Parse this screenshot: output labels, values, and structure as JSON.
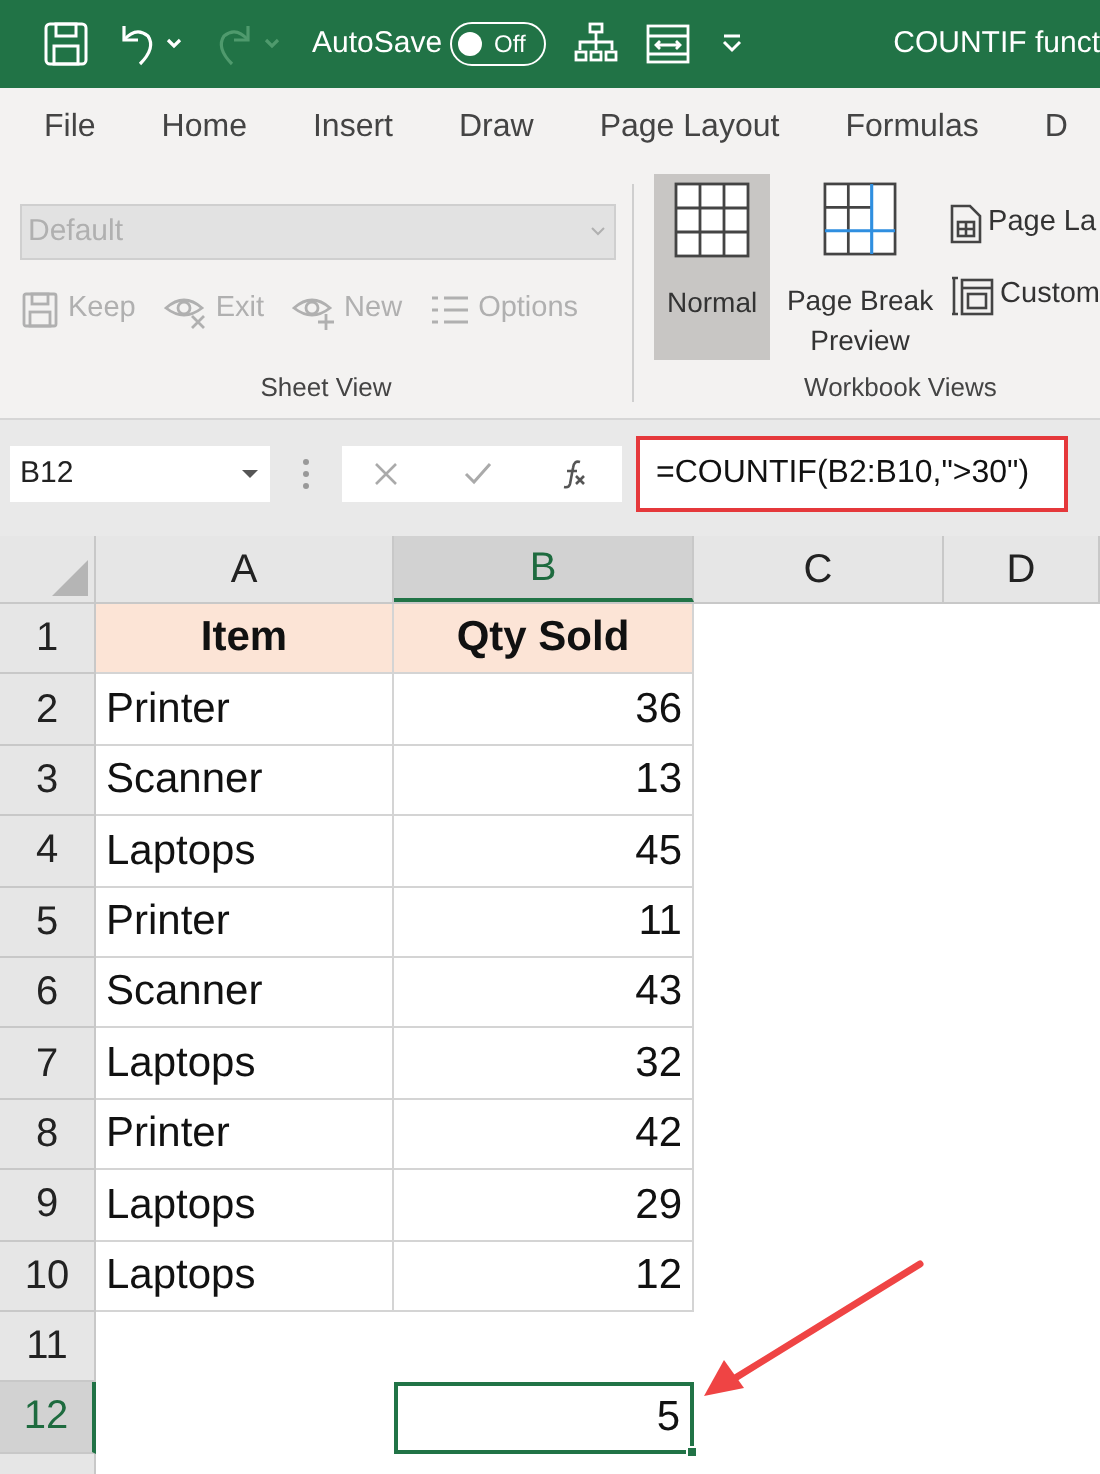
{
  "title_bar": {
    "autosave_label": "AutoSave",
    "autosave": {
      "on": false,
      "label": "Off"
    },
    "title": "COUNTIF funct"
  },
  "menu_tabs": [
    {
      "label": "File",
      "selected": false
    },
    {
      "label": "Home",
      "selected": false
    },
    {
      "label": "Insert",
      "selected": false
    },
    {
      "label": "Draw",
      "selected": false
    },
    {
      "label": "Page Layout",
      "selected": false
    },
    {
      "label": "Formulas",
      "selected": false
    },
    {
      "label": "D",
      "selected": false
    }
  ],
  "ribbon": {
    "sheet_view": {
      "style_dropdown": {
        "value": "Default",
        "disabled": true
      },
      "buttons": [
        {
          "kind": "keep",
          "label": "Keep",
          "disabled": true
        },
        {
          "kind": "exit",
          "label": "Exit",
          "disabled": true
        },
        {
          "kind": "new",
          "label": "New",
          "disabled": true
        },
        {
          "kind": "options",
          "label": "Options",
          "disabled": true
        }
      ],
      "group_label": "Sheet View"
    },
    "workbook_views": {
      "large_buttons": [
        {
          "kind": "normal",
          "label": "Normal",
          "selected": true
        },
        {
          "kind": "page_break",
          "label": "Page Break Preview",
          "selected": false
        }
      ],
      "small_buttons": [
        {
          "kind": "page_layout",
          "label": "Page La"
        },
        {
          "kind": "custom",
          "label": "Custom"
        }
      ],
      "group_label": "Workbook Views"
    }
  },
  "formula_bar": {
    "name_box": "B12",
    "formula": "=COUNTIF(B2:B10,\">30\")",
    "highlighted": true
  },
  "sheet": {
    "columns": [
      {
        "label": "A",
        "selected": false
      },
      {
        "label": "B",
        "selected": true
      },
      {
        "label": "C",
        "selected": false
      },
      {
        "label": "D",
        "selected": false
      }
    ],
    "rows": [
      {
        "number": "1",
        "selected": false,
        "kind": "header",
        "cells": [
          "Item",
          "Qty Sold"
        ]
      },
      {
        "number": "2",
        "selected": false,
        "kind": "data",
        "cells": [
          "Printer",
          "36"
        ]
      },
      {
        "number": "3",
        "selected": false,
        "kind": "data",
        "cells": [
          "Scanner",
          "13"
        ]
      },
      {
        "number": "4",
        "selected": false,
        "kind": "data",
        "cells": [
          "Laptops",
          "45"
        ]
      },
      {
        "number": "5",
        "selected": false,
        "kind": "data",
        "cells": [
          "Printer",
          "11"
        ]
      },
      {
        "number": "6",
        "selected": false,
        "kind": "data",
        "cells": [
          "Scanner",
          "43"
        ]
      },
      {
        "number": "7",
        "selected": false,
        "kind": "data",
        "cells": [
          "Laptops",
          "32"
        ]
      },
      {
        "number": "8",
        "selected": false,
        "kind": "data",
        "cells": [
          "Printer",
          "42"
        ]
      },
      {
        "number": "9",
        "selected": false,
        "kind": "data",
        "cells": [
          "Laptops",
          "29"
        ]
      },
      {
        "number": "10",
        "selected": false,
        "kind": "data",
        "cells": [
          "Laptops",
          "12"
        ]
      },
      {
        "number": "11",
        "selected": false,
        "kind": "empty",
        "cells": [
          "",
          ""
        ]
      },
      {
        "number": "12",
        "selected": true,
        "kind": "result",
        "cells": [
          "",
          "5"
        ]
      },
      {
        "selected": false,
        "kind": "empty",
        "cells": [
          "",
          ""
        ]
      }
    ]
  }
}
